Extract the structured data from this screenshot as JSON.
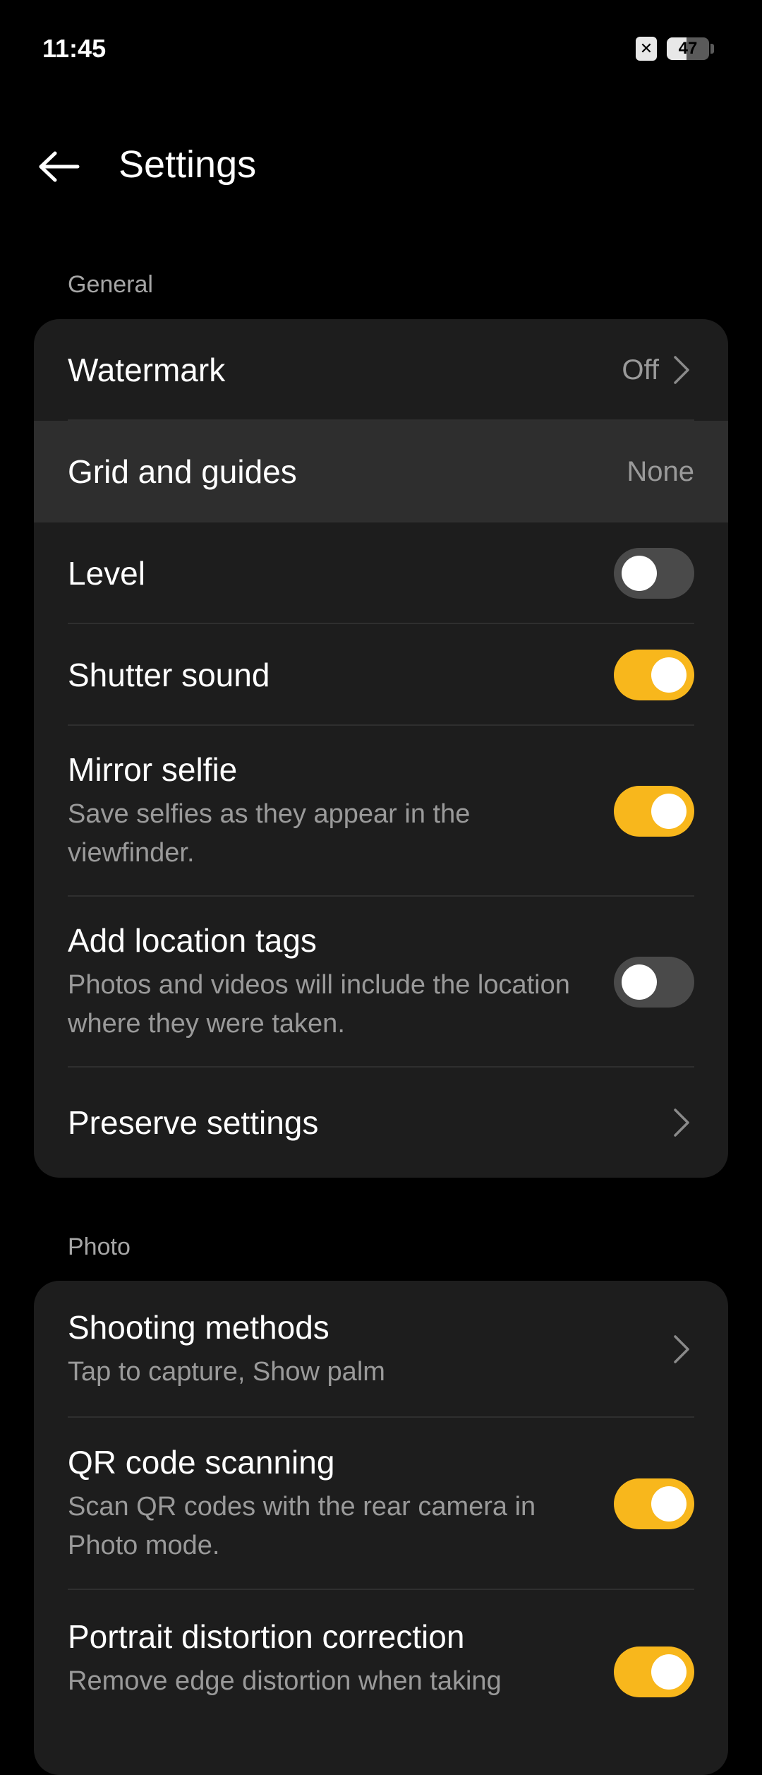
{
  "status_bar": {
    "time": "11:45",
    "sim_icon": "sim-off-icon",
    "battery_level": "47",
    "battery_fraction": 0.47
  },
  "app_bar": {
    "back_icon": "arrow-left-icon",
    "title": "Settings"
  },
  "sections": {
    "general": {
      "label": "General",
      "items": {
        "watermark": {
          "title": "Watermark",
          "value": "Off"
        },
        "grid": {
          "title": "Grid and guides",
          "value": "None"
        },
        "level": {
          "title": "Level",
          "enabled": false
        },
        "shutter": {
          "title": "Shutter sound",
          "enabled": true
        },
        "mirror": {
          "title": "Mirror selfie",
          "subtitle": "Save selfies as they appear in the viewfinder.",
          "enabled": true
        },
        "location": {
          "title": "Add location tags",
          "subtitle": "Photos and videos will include the location where they were taken.",
          "enabled": false
        },
        "preserve": {
          "title": "Preserve settings"
        }
      }
    },
    "photo": {
      "label": "Photo",
      "items": {
        "shooting": {
          "title": "Shooting methods",
          "subtitle": "Tap to capture, Show palm"
        },
        "qr": {
          "title": "QR code scanning",
          "subtitle": "Scan QR codes with the rear camera in Photo mode.",
          "enabled": true
        },
        "portrait": {
          "title": "Portrait distortion correction",
          "subtitle": "Remove edge distortion when taking",
          "enabled": true
        }
      }
    }
  },
  "colors": {
    "accent": "#f8b71c",
    "background": "#000000",
    "card": "#1d1d1d",
    "highlight": "#2e2e2e"
  }
}
